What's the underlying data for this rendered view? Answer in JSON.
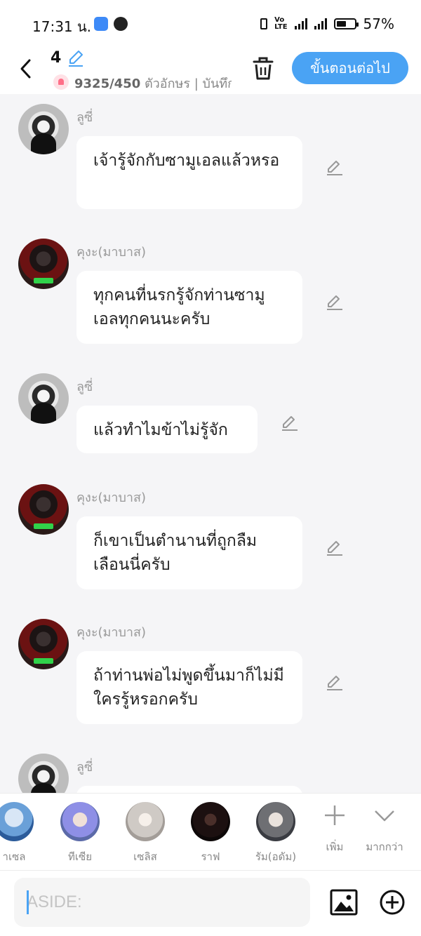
{
  "status": {
    "time": "17:31 น.",
    "battery": "57%",
    "battery_level": 57
  },
  "header": {
    "chapter_number": "4",
    "counter": "9325/450",
    "counter_suffix": " ตัวอักษร | บันทึก",
    "next_button": "ขั้นตอนต่อไป"
  },
  "messages": [
    {
      "speaker": "ลูซี่",
      "avatar": "lucy",
      "text": "เจ้ารู้จักกับซามูเอลแล้วหรอ"
    },
    {
      "speaker": "คุงะ(มาบาส)",
      "avatar": "kunga",
      "text": "ทุกคนที่นรกรู้จักท่านซามูเอลทุกคนนะครับ"
    },
    {
      "speaker": "ลูซี่",
      "avatar": "lucy",
      "text": "แล้วทำไมข้าไม่รู้จัก"
    },
    {
      "speaker": "คุงะ(มาบาส)",
      "avatar": "kunga",
      "text": "ก็เขาเป็นตำนานที่ถูกลืมเลือนนี่ครับ"
    },
    {
      "speaker": "คุงะ(มาบาส)",
      "avatar": "kunga",
      "text": "ถ้าท่านพ่อไม่พูดขึ้นมาก็ไม่มีใครรู้หรอกครับ"
    },
    {
      "speaker": "ลูซี่",
      "avatar": "lucy",
      "text": ""
    }
  ],
  "characters": [
    {
      "name": "าเซล"
    },
    {
      "name": "ทีเซีย"
    },
    {
      "name": "เซลิส"
    },
    {
      "name": "ราฟ"
    },
    {
      "name": "รัม(อดัม)"
    }
  ],
  "toolbar": {
    "add_label": "เพิ่ม",
    "more_label": "มากกว่า"
  },
  "input": {
    "placeholder": "ASIDE:"
  },
  "icons": {
    "back": "chevron-left-icon",
    "edit_title": "pencil-icon",
    "trash": "trash-icon",
    "edit_message": "pencil-icon",
    "add": "plus-icon",
    "more": "chevron-down-icon",
    "image": "image-icon",
    "attach": "plus-circle-icon"
  },
  "colors": {
    "accent": "#4aa3f4",
    "background": "#f5f5f7",
    "bubble": "#ffffff"
  }
}
